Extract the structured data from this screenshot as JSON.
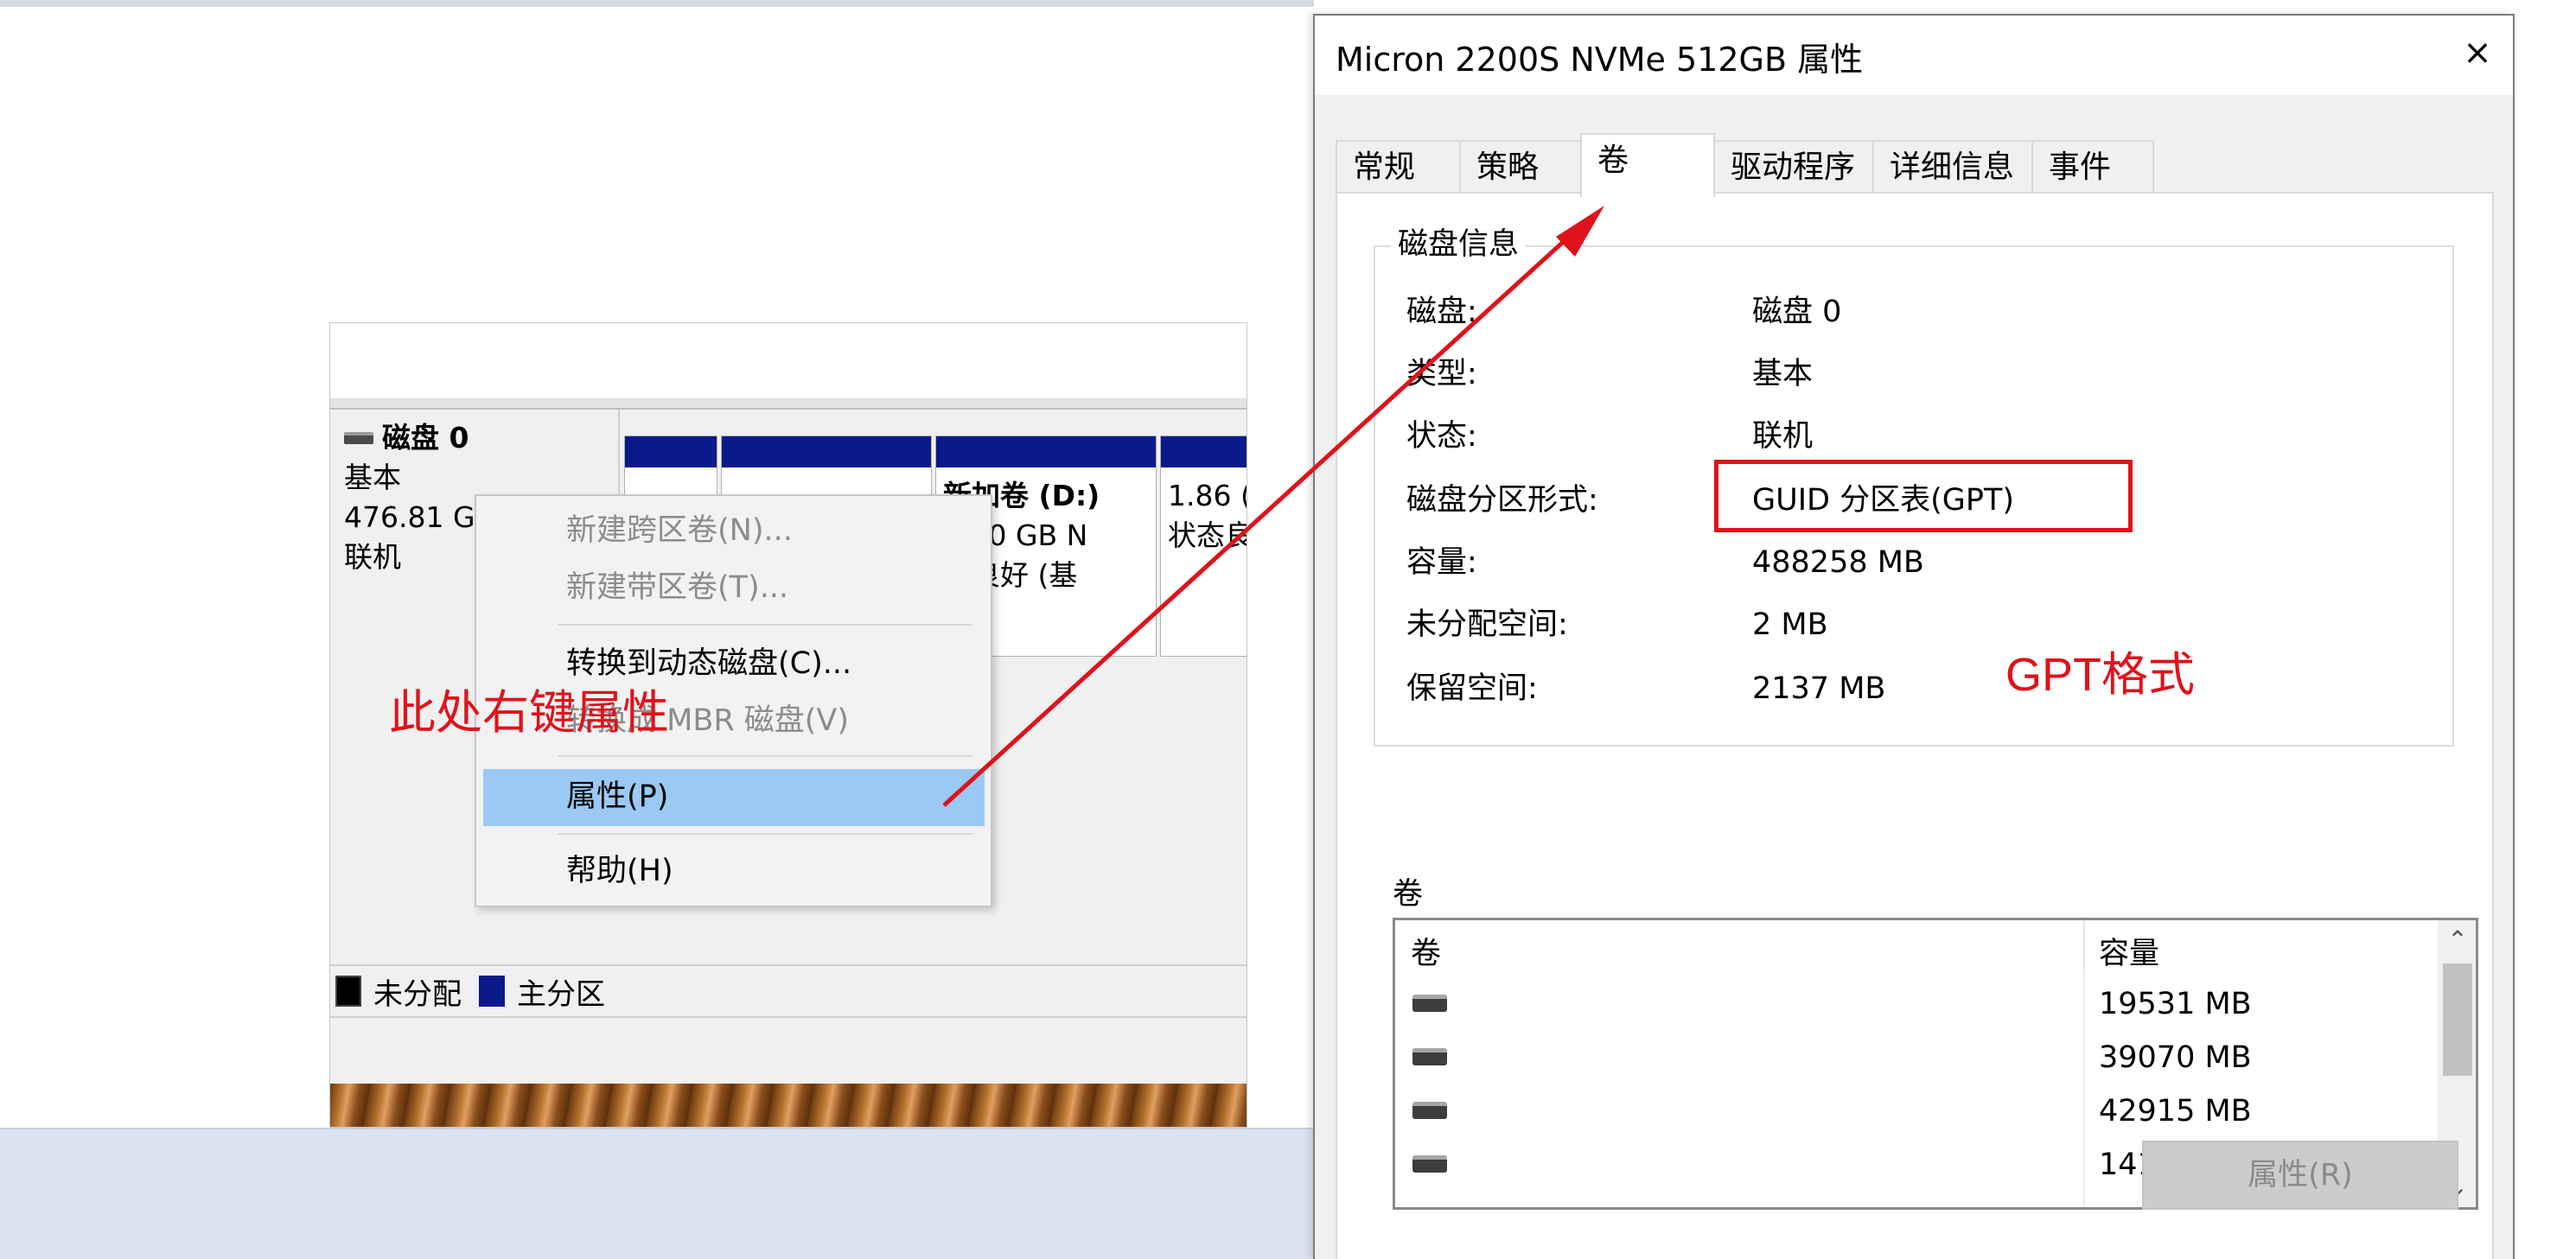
{
  "disk_mgmt": {
    "disk_name": "磁盘 0",
    "disk_type": "基本",
    "disk_size": "476.81 G",
    "disk_status": "联机",
    "partitions": [
      {
        "line1": "",
        "line2": ""
      },
      {
        "line1": "",
        "line2": ""
      },
      {
        "line1": "新加卷 (D:)",
        "line2": "9.00 GB N",
        "line3": "态良好 (基"
      },
      {
        "line1": "",
        "line2": "1.86 (",
        "line3": "状态良"
      }
    ],
    "legend": {
      "unallocated": "未分配",
      "primary": "主分区"
    }
  },
  "context_menu": {
    "items": [
      {
        "label": "新建跨区卷(N)...",
        "disabled": true
      },
      {
        "label": "新建带区卷(T)...",
        "disabled": true
      },
      {
        "label": "转换到动态磁盘(C)...",
        "disabled": false
      },
      {
        "label": "转换成 MBR 磁盘(V)",
        "disabled": true
      },
      {
        "label": "属性(P)",
        "disabled": false,
        "highlighted": true
      },
      {
        "label": "帮助(H)",
        "disabled": false
      }
    ]
  },
  "annotations": {
    "left": "此处右键属性",
    "right": "GPT格式",
    "color": "#e0121b"
  },
  "dialog": {
    "title": "Micron 2200S NVMe 512GB 属性",
    "close_glyph": "×",
    "tabs": [
      {
        "label": "常规",
        "active": false
      },
      {
        "label": "策略",
        "active": false
      },
      {
        "label": "卷",
        "active": true
      },
      {
        "label": "驱动程序",
        "active": false
      },
      {
        "label": "详细信息",
        "active": false
      },
      {
        "label": "事件",
        "active": false
      }
    ],
    "disk_info": {
      "title": "磁盘信息",
      "rows": [
        {
          "key": "磁盘:",
          "value": "磁盘 0"
        },
        {
          "key": "类型:",
          "value": "基本"
        },
        {
          "key": "状态:",
          "value": "联机"
        },
        {
          "key": "磁盘分区形式:",
          "value": "GUID 分区表(GPT)"
        },
        {
          "key": "容量:",
          "value": "488258 MB"
        },
        {
          "key": "未分配空间:",
          "value": "2 MB"
        },
        {
          "key": "保留空间:",
          "value": "2137 MB"
        }
      ]
    },
    "volumes": {
      "label": "卷",
      "columns": [
        "卷",
        "容量"
      ],
      "rows": [
        {
          "name": "",
          "capacity": "19531 MB"
        },
        {
          "name": "",
          "capacity": "39070 MB"
        },
        {
          "name": "",
          "capacity": "42915 MB"
        },
        {
          "name": "",
          "capacity": "14106 MB"
        }
      ]
    },
    "properties_button": "属性(R)"
  }
}
